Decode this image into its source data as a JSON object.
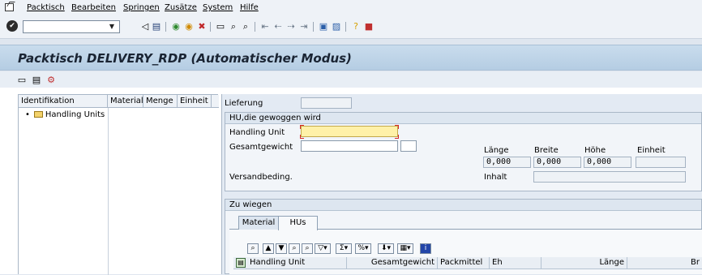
{
  "menu": {
    "items": [
      "Packtisch",
      "Bearbeiten",
      "Springen",
      "Zusätze",
      "System",
      "Hilfe"
    ]
  },
  "toolbar": {
    "command_value": "",
    "icons": [
      "enter-icon",
      "back-icon",
      "save-icon",
      "back-nav-icon",
      "exit-icon",
      "cancel-icon",
      "print-icon",
      "find-icon",
      "find-next-icon",
      "first-page-icon",
      "prev-page-icon",
      "next-page-icon",
      "last-page-icon",
      "new-session-icon",
      "shortcut-icon",
      "help-icon",
      "layout-icon"
    ]
  },
  "title": "Packtisch DELIVERY_RDP (Automatischer Modus)",
  "tree": {
    "columns": [
      "Identifikation",
      "Material",
      "Menge",
      "Einheit"
    ],
    "nodes": [
      {
        "label": "Handling Units"
      }
    ]
  },
  "form": {
    "lieferung_label": "Lieferung",
    "lieferung_value": "",
    "weigh_group": {
      "title": "HU,die gewoggen wird",
      "handling_unit_label": "Handling Unit",
      "handling_unit_value": "",
      "gesamtgewicht_label": "Gesamtgewicht",
      "gesamtgewicht_value": "",
      "unit_value": "",
      "laenge_label": "Länge",
      "breite_label": "Breite",
      "hoehe_label": "Höhe",
      "einheit_label": "Einheit",
      "laenge_value": "0,000",
      "breite_value": "0,000",
      "hoehe_value": "0,000",
      "einheit_value": "",
      "versandbeding_label": "Versandbeding.",
      "inhalt_label": "Inhalt",
      "inhalt_value": ""
    },
    "zu_wiegen": {
      "title": "Zu wiegen",
      "tabs": [
        "Material",
        "HUs"
      ],
      "active_tab": "HUs",
      "columns": [
        "Handling Unit",
        "Gesamtgewicht",
        "Packmittel",
        "Eh",
        "Länge",
        "Br"
      ]
    }
  }
}
